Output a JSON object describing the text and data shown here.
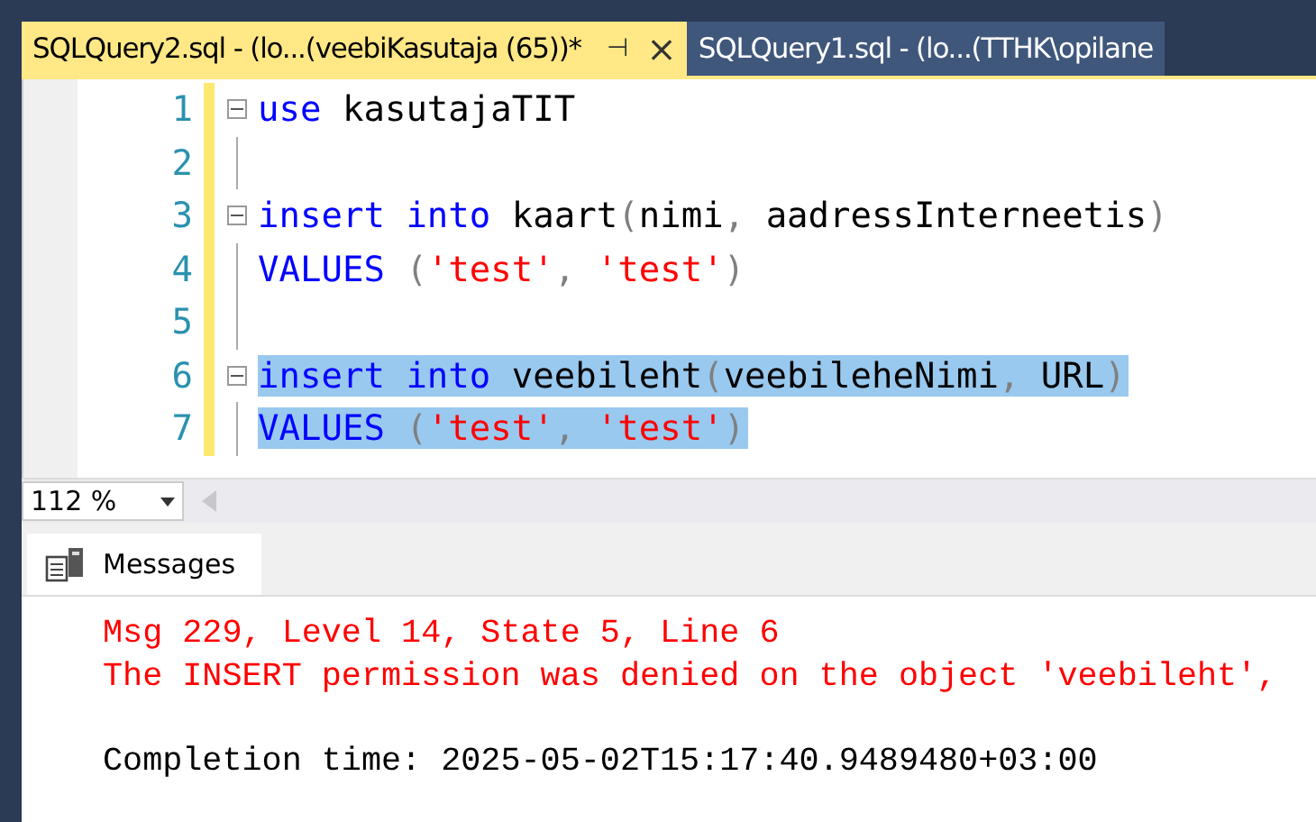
{
  "tabs": [
    {
      "label": "SQLQuery2.sql - (lo...(veebiKasutaja (65))*",
      "selected": true,
      "pin": "⊣",
      "close": "×"
    },
    {
      "label": "SQLQuery1.sql - (lo...(TTHK\\opilane",
      "selected": false
    }
  ],
  "editor": {
    "lines": [
      {
        "number": "1",
        "fold": true,
        "selected": false,
        "tokens": [
          {
            "kind": "keyword",
            "text": "use"
          },
          {
            "kind": "plain",
            "text": " kasutajaTIT"
          }
        ]
      },
      {
        "number": "2",
        "fold": false,
        "selected": false
      },
      {
        "number": "3",
        "fold": true,
        "selected": false,
        "tokens": [
          {
            "kind": "keyword",
            "text": "insert"
          },
          {
            "kind": "keyword",
            "text": " into"
          },
          {
            "kind": "plain",
            "text": " kaart"
          },
          {
            "kind": "punct",
            "text": "("
          },
          {
            "kind": "plain",
            "text": "nimi"
          },
          {
            "kind": "punct",
            "text": ","
          },
          {
            "kind": "plain",
            "text": " aadressInterneetis"
          },
          {
            "kind": "punct",
            "text": ")"
          }
        ]
      },
      {
        "number": "4",
        "fold": false,
        "selected": false,
        "tokens": [
          {
            "kind": "keyword",
            "text": "VALUES"
          },
          {
            "kind": "punct",
            "text": " ("
          },
          {
            "kind": "string",
            "text": "'test'"
          },
          {
            "kind": "punct",
            "text": ","
          },
          {
            "kind": "string",
            "text": " 'test'"
          },
          {
            "kind": "punct",
            "text": ")"
          }
        ]
      },
      {
        "number": "5",
        "fold": false,
        "selected": false
      },
      {
        "number": "6",
        "fold": true,
        "selected": true,
        "tokens": [
          {
            "kind": "keyword",
            "text": "insert"
          },
          {
            "kind": "keyword",
            "text": " into"
          },
          {
            "kind": "plain",
            "text": " veebileht"
          },
          {
            "kind": "punct",
            "text": "("
          },
          {
            "kind": "plain",
            "text": "veebileheNimi"
          },
          {
            "kind": "punct",
            "text": ","
          },
          {
            "kind": "plain",
            "text": " URL"
          },
          {
            "kind": "punct",
            "text": ")"
          }
        ]
      },
      {
        "number": "7",
        "fold": false,
        "selected": true,
        "tokens": [
          {
            "kind": "keyword",
            "text": "VALUES"
          },
          {
            "kind": "punct",
            "text": " ("
          },
          {
            "kind": "string",
            "text": "'test'"
          },
          {
            "kind": "punct",
            "text": ","
          },
          {
            "kind": "string",
            "text": " 'test'"
          },
          {
            "kind": "punct",
            "text": ")"
          }
        ]
      }
    ],
    "zoom": "112 %"
  },
  "results": {
    "tab": "Messages",
    "messages": [
      {
        "kind": "error",
        "text": "Msg 229, Level 14, State 5, Line 6"
      },
      {
        "kind": "error",
        "text": "The INSERT permission was denied on the object 'veebileht',"
      },
      {
        "kind": "blank"
      },
      {
        "kind": "info",
        "text": "Completion time: 2025-05-02T15:17:40.9489480+03:00"
      }
    ]
  }
}
